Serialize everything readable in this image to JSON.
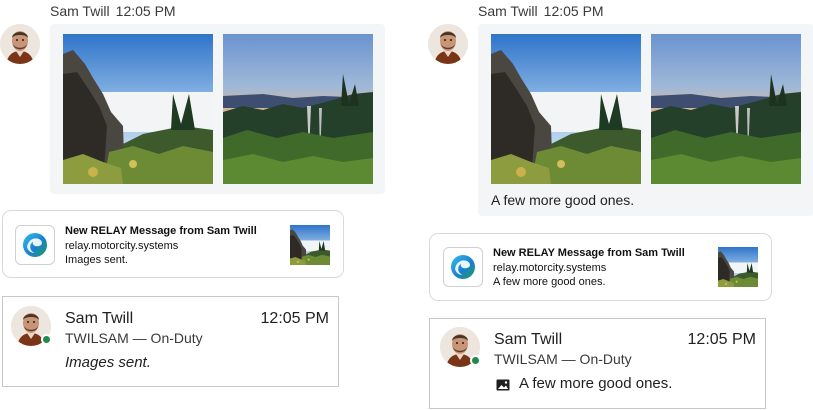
{
  "left": {
    "chat": {
      "sender": "Sam Twill",
      "time": "12:05 PM",
      "photos": [
        "cliff-above-clouds",
        "sunset-over-forest"
      ],
      "caption": ""
    },
    "toast": {
      "title": "New RELAY Message from Sam Twill",
      "source": "relay.motorcity.systems",
      "message": "Images sent."
    },
    "card": {
      "name": "Sam Twill",
      "time": "12:05 PM",
      "status": "TWILSAM — On-Duty",
      "message": "Images sent."
    }
  },
  "right": {
    "chat": {
      "sender": "Sam Twill",
      "time": "12:05 PM",
      "photos": [
        "cliff-above-clouds",
        "sunset-over-forest"
      ],
      "caption": "A few more good ones."
    },
    "toast": {
      "title": "New RELAY Message from Sam Twill",
      "source": "relay.motorcity.systems",
      "message": "A few more good ones."
    },
    "card": {
      "name": "Sam Twill",
      "time": "12:05 PM",
      "status": "TWILSAM — On-Duty",
      "message": "A few more good ones."
    }
  },
  "icons": {
    "app": "edge-browser-icon",
    "attachment": "image-icon",
    "presence": "presence-available-icon"
  },
  "colors": {
    "bubble": "#f4f5f7",
    "presence": "#1f8a4c",
    "toast_border": "#d9d9d9",
    "card_border": "#c9c9c9"
  }
}
